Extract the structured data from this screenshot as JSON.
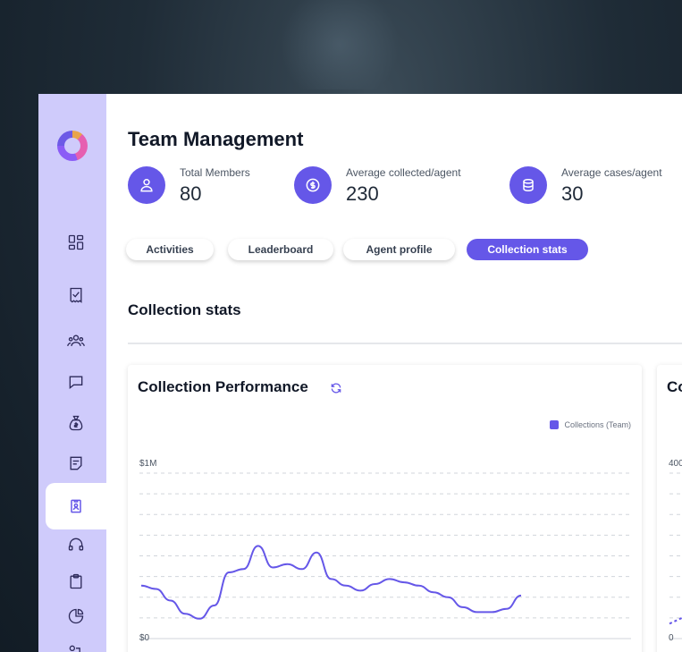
{
  "app": {
    "title": "Team Management"
  },
  "sidebar": {
    "items": [
      {
        "icon": "dashboard-icon"
      },
      {
        "icon": "receipt-check-icon"
      },
      {
        "icon": "team-icon"
      },
      {
        "icon": "chat-icon"
      },
      {
        "icon": "money-bag-icon"
      },
      {
        "icon": "document-icon"
      },
      {
        "icon": "id-badge-icon",
        "active": true
      },
      {
        "icon": "headset-icon"
      },
      {
        "icon": "clipboard-icon"
      },
      {
        "icon": "pie-chart-icon"
      },
      {
        "icon": "transfer-icon"
      }
    ]
  },
  "stats": [
    {
      "label": "Total Members",
      "value": "80",
      "icon": "user-icon"
    },
    {
      "label": "Average collected/agent",
      "value": "230",
      "icon": "dollar-coin-icon"
    },
    {
      "label": "Average cases/agent",
      "value": "30",
      "icon": "database-icon"
    }
  ],
  "tabs": [
    {
      "label": "Activities"
    },
    {
      "label": "Leaderboard"
    },
    {
      "label": "Agent profile"
    },
    {
      "label": "Collection stats",
      "active": true
    }
  ],
  "section": {
    "title": "Collection stats"
  },
  "cards": [
    {
      "title": "Collection Performance",
      "icon": "refresh-icon"
    },
    {
      "title": "Co"
    }
  ],
  "colors": {
    "accent": "#6557e8",
    "sidebar_bg": "#cfcbfb"
  },
  "chart_data": [
    {
      "type": "line",
      "title": "Collection Performance",
      "legend": [
        "Collections (Team)"
      ],
      "legend_position": "top-right",
      "y_tick_labels": [
        "$1M",
        "$0"
      ],
      "ylim": [
        0,
        1000000
      ],
      "grid": true,
      "series": [
        {
          "name": "Collections (Team)",
          "values": [
            320000,
            300000,
            230000,
            150000,
            120000,
            200000,
            400000,
            420000,
            560000,
            430000,
            450000,
            420000,
            520000,
            360000,
            320000,
            290000,
            330000,
            360000,
            340000,
            320000,
            280000,
            250000,
            190000,
            160000,
            160000,
            180000,
            260000
          ]
        }
      ]
    },
    {
      "type": "line",
      "title": "Co",
      "y_tick_labels": [
        "400",
        "0"
      ],
      "series": [
        {
          "values": [
            90,
            130,
            150
          ]
        }
      ]
    }
  ]
}
